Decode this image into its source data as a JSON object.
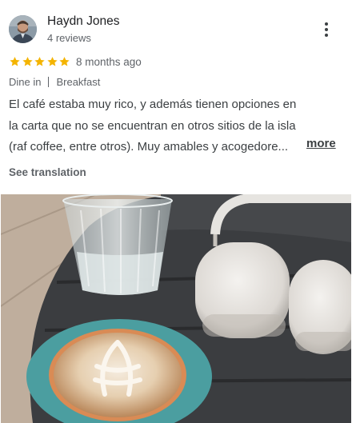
{
  "review": {
    "author": "Haydn Jones",
    "reviews_count": "4 reviews",
    "rating": 5,
    "time": "8 months ago",
    "service": "Dine in",
    "meal": "Breakfast",
    "text_lines": [
      "El café estaba muy rico, y además tienen opciones en",
      "la carta que no se encuentran en otros sitios de la isla",
      "(raf coffee, entre otros). Muy amables y acogedore..."
    ],
    "more_label": "more",
    "translate_label": "See translation"
  },
  "colors": {
    "star": "#f4b400",
    "secondary_text": "#5f6368",
    "primary_text": "#202124",
    "body_text": "#3c4043"
  },
  "icons": {
    "menu": "more-vert-icon",
    "star": "star-icon"
  }
}
